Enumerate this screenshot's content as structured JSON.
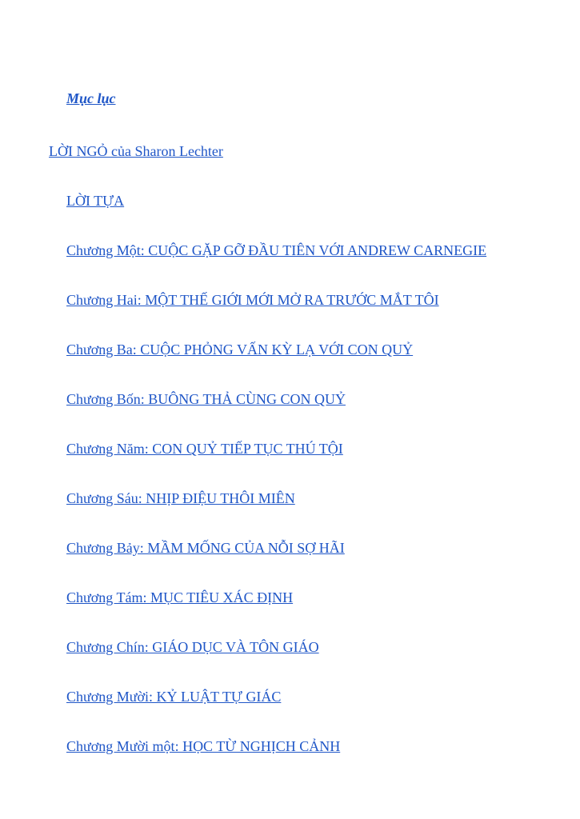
{
  "toc": {
    "heading": "Mục lục",
    "entries": [
      "LỜI NGỎ của Sharon Lechter",
      "LỜI TỰA",
      "Chương Một: CUỘC GẶP GỠ ĐẦU TIÊN VỚI ANDREW CARNEGIE",
      "Chương Hai: MỘT THẾ GIỚI MỚI MỞ RA TRƯỚC MẮT TÔI",
      "Chương Ba: CUỘC PHỎNG VẤN KỲ LẠ VỚI CON QUỶ",
      "Chương Bốn: BUÔNG THẢ CÙNG CON QUỶ",
      "Chương Năm: CON QUỶ TIẾP TỤC THÚ TỘI",
      "Chương Sáu: NHỊP ĐIỆU THÔI MIÊN",
      "Chương Bảy: MẦM MỐNG CỦA NỖI SỢ HÃI",
      "Chương Tám: MỤC TIÊU XÁC ĐỊNH",
      "Chương Chín: GIÁO DỤC VÀ TÔN GIÁO",
      "Chương Mười: KỶ LUẬT TỰ GIÁC",
      "Chương Mười một: HỌC TỪ NGHỊCH CẢNH"
    ]
  },
  "colors": {
    "link": "#1f56c7",
    "background": "#ffffff"
  }
}
